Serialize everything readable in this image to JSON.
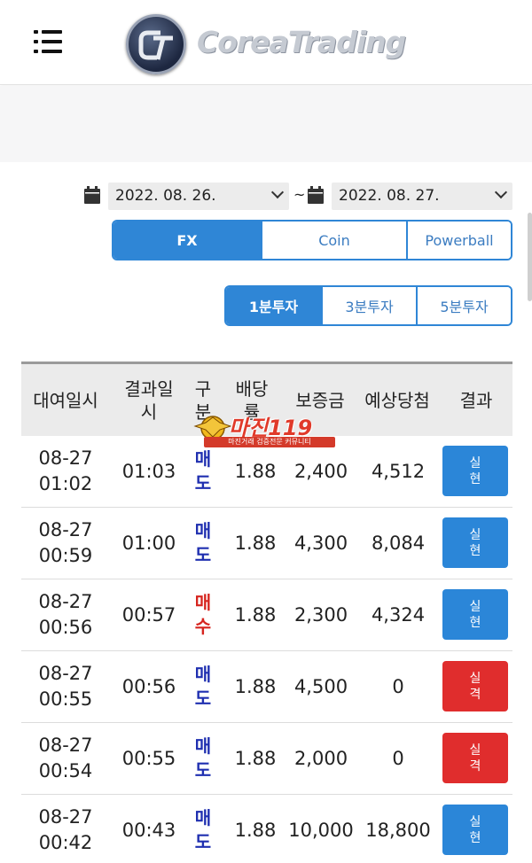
{
  "header": {
    "brand": "CoreaTrading",
    "logo_letters": "CT"
  },
  "filters": {
    "date_from": "2022. 08. 26.",
    "separator": "~",
    "date_to": "2022. 08. 27."
  },
  "market_tabs": [
    {
      "label": "FX",
      "active": true
    },
    {
      "label": "Coin",
      "active": false
    },
    {
      "label": "Powerball",
      "active": false
    }
  ],
  "term_tabs": [
    {
      "label": "1분투자",
      "active": true
    },
    {
      "label": "3분투자",
      "active": false
    },
    {
      "label": "5분투자",
      "active": false
    }
  ],
  "table": {
    "headers": [
      "대여일시",
      "결과일시",
      "구분",
      "배당률",
      "보증금",
      "예상당첨",
      "결과"
    ],
    "rows": [
      {
        "date": "08-27",
        "time": "01:02",
        "result_time": "01:03",
        "type": "매도",
        "rate": "1.88",
        "deposit": "2,400",
        "expected": "4,512",
        "result": "실현"
      },
      {
        "date": "08-27",
        "time": "00:59",
        "result_time": "01:00",
        "type": "매도",
        "rate": "1.88",
        "deposit": "4,300",
        "expected": "8,084",
        "result": "실현"
      },
      {
        "date": "08-27",
        "time": "00:56",
        "result_time": "00:57",
        "type": "매수",
        "rate": "1.88",
        "deposit": "2,300",
        "expected": "4,324",
        "result": "실현"
      },
      {
        "date": "08-27",
        "time": "00:55",
        "result_time": "00:56",
        "type": "매도",
        "rate": "1.88",
        "deposit": "4,500",
        "expected": "0",
        "result": "실격"
      },
      {
        "date": "08-27",
        "time": "00:54",
        "result_time": "00:55",
        "type": "매도",
        "rate": "1.88",
        "deposit": "2,000",
        "expected": "0",
        "result": "실격"
      },
      {
        "date": "08-27",
        "time": "00:42",
        "result_time": "00:43",
        "type": "매도",
        "rate": "1.88",
        "deposit": "10,000",
        "expected": "18,800",
        "result": "실현"
      }
    ]
  },
  "watermark": {
    "title": "마진119",
    "subtitle": "마진거래 검증전문 커뮤니티"
  },
  "colors": {
    "accent": "#2f86d6",
    "win": "#2b86d8",
    "lose": "#e02d2d",
    "sell": "#1f2fb0",
    "buy": "#d6241e"
  }
}
